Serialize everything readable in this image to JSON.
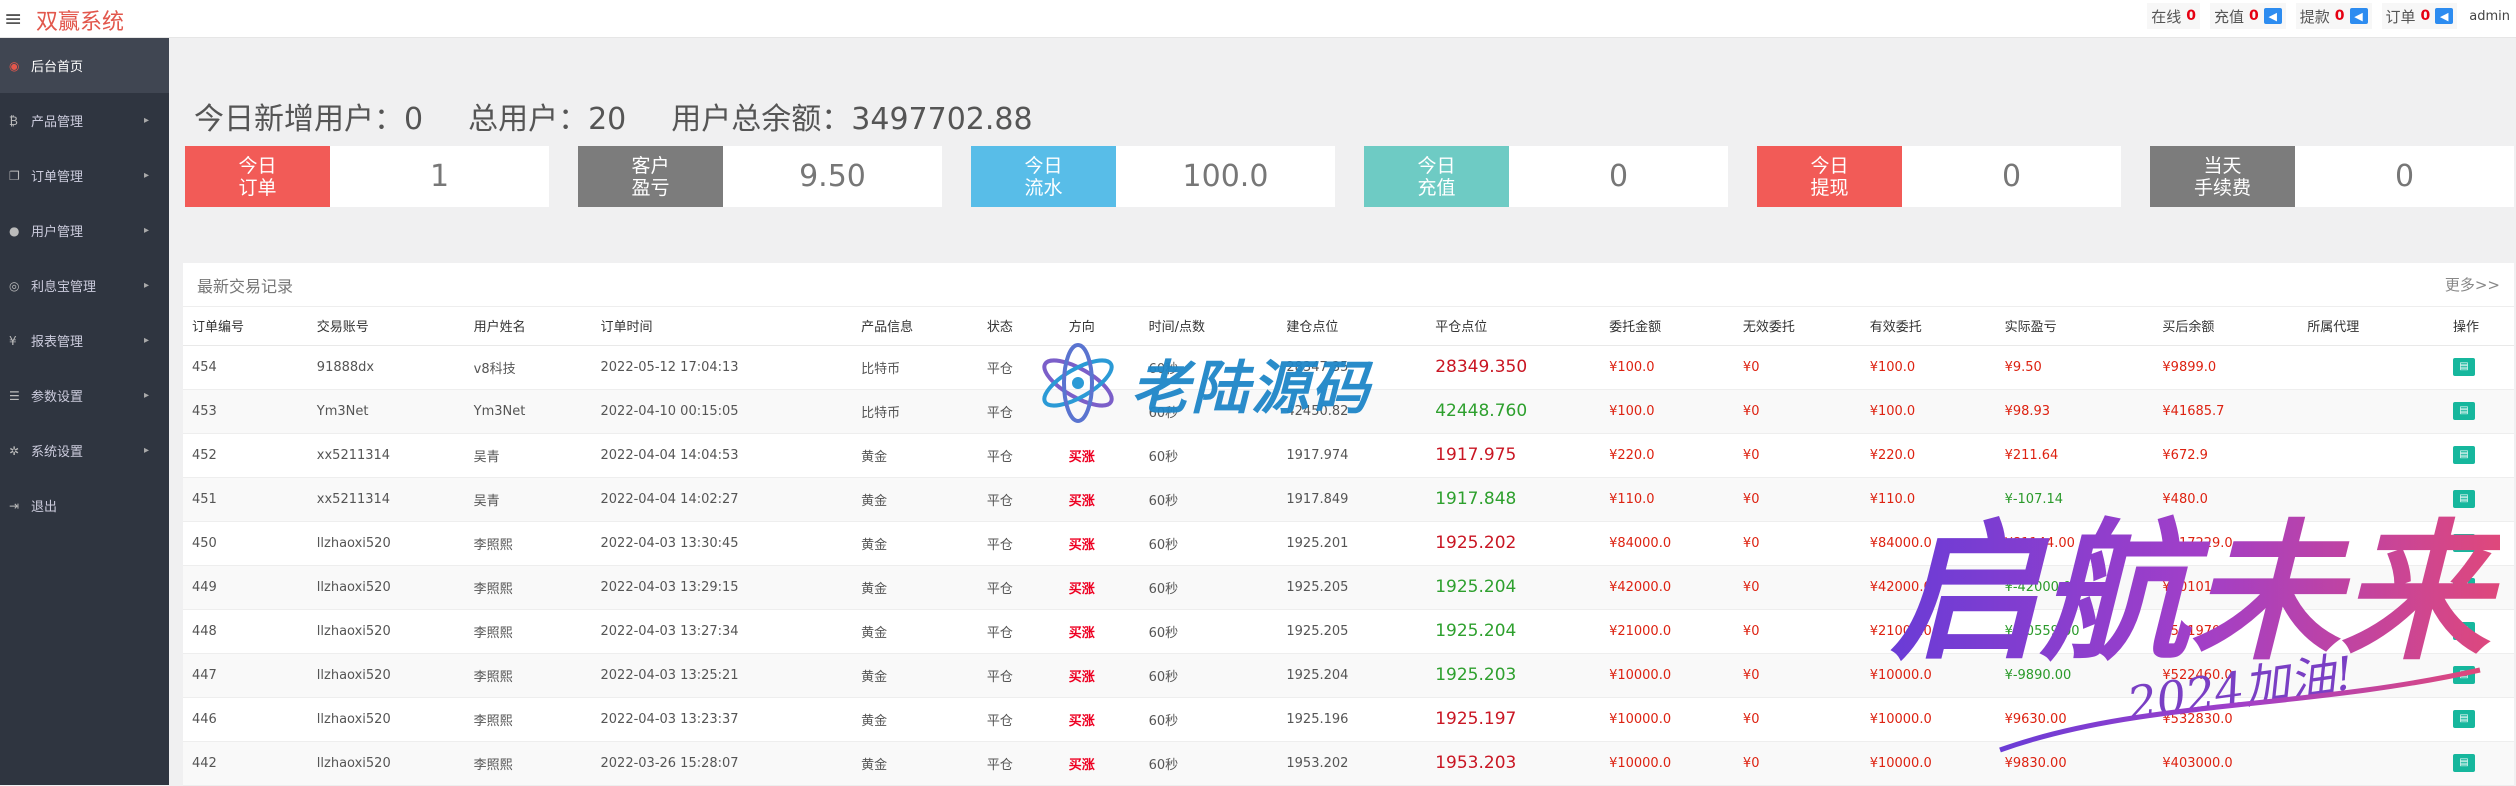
{
  "header": {
    "brand": "双赢系统",
    "online_label": "在线",
    "online_count": "0",
    "recharge_label": "充值",
    "recharge_count": "0",
    "withdraw_label": "提款",
    "withdraw_count": "0",
    "order_label": "订单",
    "order_count": "0",
    "admin": "admin"
  },
  "sidebar": {
    "items": [
      {
        "label": "后台首页",
        "icon": "dashboard-icon",
        "active": true
      },
      {
        "label": "产品管理",
        "icon": "bitcoin-icon"
      },
      {
        "label": "订单管理",
        "icon": "copy-icon"
      },
      {
        "label": "用户管理",
        "icon": "user-icon"
      },
      {
        "label": "利息宝管理",
        "icon": "piggy-icon"
      },
      {
        "label": "报表管理",
        "icon": "yen-icon"
      },
      {
        "label": "参数设置",
        "icon": "sliders-icon"
      },
      {
        "label": "系统设置",
        "icon": "gears-icon"
      },
      {
        "label": "退出",
        "icon": "logout-icon"
      }
    ]
  },
  "summary": {
    "new_users": "今日新增用户：0",
    "total_users": "总用户：20",
    "total_balance": "用户总余额：3497702.88"
  },
  "cards": [
    {
      "label": "今日\n订单",
      "value": "1",
      "color": "#f25b57"
    },
    {
      "label": "客户\n盈亏",
      "value": "9.50",
      "color": "#7c7c7c"
    },
    {
      "label": "今日\n流水",
      "value": "100.0",
      "color": "#58bde8"
    },
    {
      "label": "今日\n充值",
      "value": "0",
      "color": "#6ecbc4"
    },
    {
      "label": "今日\n提现",
      "value": "0",
      "color": "#f25b57"
    },
    {
      "label": "当天\n手续费",
      "value": "0",
      "color": "#7c7c7c"
    }
  ],
  "panel": {
    "title": "最新交易记录",
    "more": "更多>>"
  },
  "table": {
    "columns": [
      "订单编号",
      "交易账号",
      "用户姓名",
      "订单时间",
      "产品信息",
      "状态",
      "方向",
      "时间/点数",
      "建仓点位",
      "平仓点位",
      "委托金额",
      "无效委托",
      "有效委托",
      "实际盈亏",
      "买后余额",
      "所属代理",
      "操作"
    ],
    "rows": [
      [
        "454",
        "91888dx",
        "v8科技",
        "2022-05-12 17:04:13",
        "比特币",
        "平仓",
        "",
        "60秒",
        "28347.35",
        "28349.350",
        "¥100.0",
        "¥0",
        "¥100.0",
        "¥9.50",
        "¥9899.0",
        "",
        ""
      ],
      [
        "453",
        "Ym3Net",
        "Ym3Net",
        "2022-04-10 00:15:05",
        "比特币",
        "平仓",
        "",
        "60秒",
        "42450.82",
        "42448.760",
        "¥100.0",
        "¥0",
        "¥100.0",
        "¥98.93",
        "¥41685.7",
        "",
        ""
      ],
      [
        "452",
        "xx5211314",
        "吴青",
        "2022-04-04 14:04:53",
        "黄金",
        "平仓",
        "买涨",
        "60秒",
        "1917.974",
        "1917.975",
        "¥220.0",
        "¥0",
        "¥220.0",
        "¥211.64",
        "¥672.9",
        "",
        ""
      ],
      [
        "451",
        "xx5211314",
        "吴青",
        "2022-04-04 14:02:27",
        "黄金",
        "平仓",
        "买涨",
        "60秒",
        "1917.849",
        "1917.848",
        "¥110.0",
        "¥0",
        "¥110.0",
        "¥-107.14",
        "¥480.0",
        "",
        ""
      ],
      [
        "450",
        "llzhaoxi520",
        "李照熙",
        "2022-04-03 13:30:45",
        "黄金",
        "平仓",
        "买涨",
        "60秒",
        "1925.201",
        "1925.202",
        "¥84000.0",
        "¥0",
        "¥84000.0",
        "¥81144.00",
        "¥617229.0",
        "",
        ""
      ],
      [
        "449",
        "llzhaoxi520",
        "李照熙",
        "2022-04-03 13:29:15",
        "黄金",
        "平仓",
        "买涨",
        "60秒",
        "1925.205",
        "1925.204",
        "¥42000.0",
        "¥0",
        "¥42000.0",
        "¥-42000.0",
        "¥501011.0",
        "",
        ""
      ],
      [
        "448",
        "llzhaoxi520",
        "李照熙",
        "2022-04-03 13:27:34",
        "黄金",
        "平仓",
        "买涨",
        "60秒",
        "1925.205",
        "1925.204",
        "¥21000.0",
        "¥0",
        "¥21000.0",
        "¥-20559.00",
        "¥501970.0",
        "",
        ""
      ],
      [
        "447",
        "llzhaoxi520",
        "李照熙",
        "2022-04-03 13:25:21",
        "黄金",
        "平仓",
        "买涨",
        "60秒",
        "1925.204",
        "1925.203",
        "¥10000.0",
        "¥0",
        "¥10000.0",
        "¥-9890.00",
        "¥522460.0",
        "",
        ""
      ],
      [
        "446",
        "llzhaoxi520",
        "李照熙",
        "2022-04-03 13:23:37",
        "黄金",
        "平仓",
        "买涨",
        "60秒",
        "1925.196",
        "1925.197",
        "¥10000.0",
        "¥0",
        "¥10000.0",
        "¥9630.00",
        "¥532830.0",
        "",
        ""
      ],
      [
        "442",
        "llzhaoxi520",
        "李照熙",
        "2022-03-26 15:28:07",
        "黄金",
        "平仓",
        "买涨",
        "60秒",
        "1953.202",
        "1953.203",
        "¥10000.0",
        "¥0",
        "¥10000.0",
        "¥9830.00",
        "¥403000.0",
        "",
        ""
      ]
    ]
  },
  "watermarks": {
    "primary": "老陆源码",
    "secondary": "启航未来",
    "tagline": "2024加油!"
  }
}
